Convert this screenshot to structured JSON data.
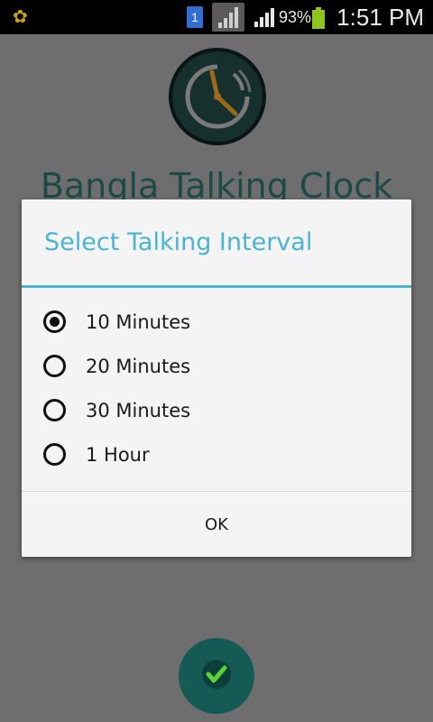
{
  "status_bar": {
    "sim_slot": "1",
    "battery_percent": "93%",
    "time": "1:51 PM",
    "icons": [
      "settings-gear-icon",
      "sim-card-icon",
      "signal-strength-icon",
      "signal-strength-icon",
      "battery-icon"
    ]
  },
  "app": {
    "title": "Bangla Talking Clock",
    "logo_icon": "clock-logo-icon",
    "fab_icon": "checkmark-icon"
  },
  "dialog": {
    "title": "Select Talking Interval",
    "options": [
      {
        "label": "10 Minutes",
        "checked": true
      },
      {
        "label": "20 Minutes",
        "checked": false
      },
      {
        "label": "30 Minutes",
        "checked": false
      },
      {
        "label": "1 Hour",
        "checked": false
      }
    ],
    "ok_label": "OK"
  },
  "colors": {
    "accent": "#4ab4d2",
    "app_title": "#1d4a46",
    "fab": "#155a55",
    "check": "#5bd13a"
  }
}
